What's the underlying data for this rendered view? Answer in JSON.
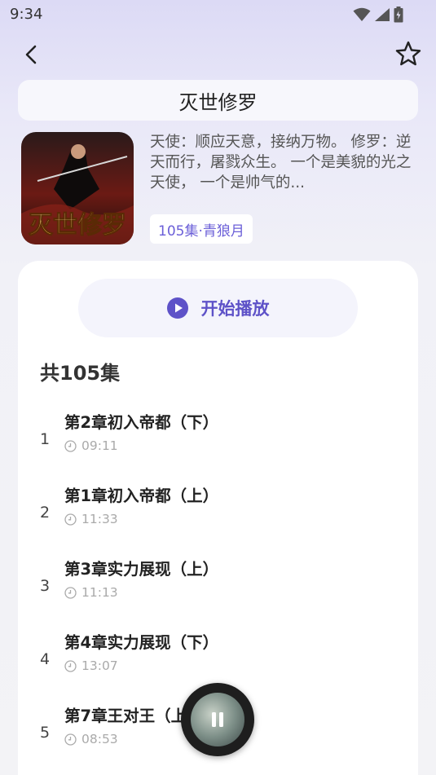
{
  "status_bar": {
    "time": "9:34"
  },
  "drama": {
    "title": "灭世修罗",
    "cover_text": "灭世修罗",
    "description": "天使：顺应天意，接纳万物。 修罗：逆天而行，屠戮众生。 一个是美貌的光之天使， 一个是帅气的...",
    "tag": "105集·青狼月"
  },
  "actions": {
    "play_label": "开始播放"
  },
  "episodes_header": "共105集",
  "episodes": [
    {
      "num": "1",
      "title": "第2章初入帝都（下）",
      "duration": "09:11"
    },
    {
      "num": "2",
      "title": "第1章初入帝都（上）",
      "duration": "11:33"
    },
    {
      "num": "3",
      "title": "第3章实力展现（上）",
      "duration": "11:13"
    },
    {
      "num": "4",
      "title": "第4章实力展现（下）",
      "duration": "13:07"
    },
    {
      "num": "5",
      "title": "第7章王对王（上）",
      "duration": "08:53"
    }
  ],
  "colors": {
    "accent": "#5e52c8",
    "tag_text": "#6b5fd8"
  },
  "icons": [
    "wifi-icon",
    "signal-icon",
    "battery-icon",
    "back-arrow-icon",
    "star-icon",
    "play-circle-icon",
    "clock-icon",
    "pause-icon"
  ]
}
